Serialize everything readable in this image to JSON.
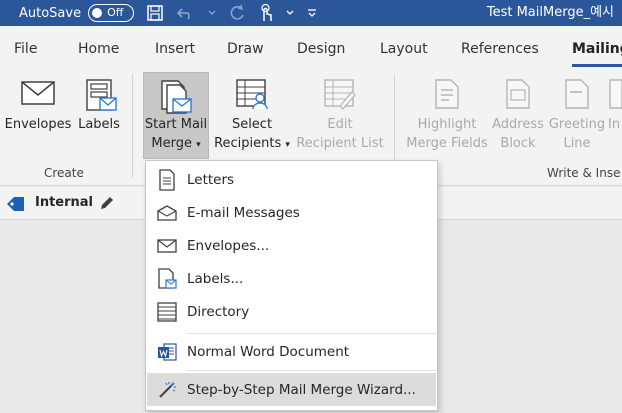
{
  "titlebar": {
    "autosave_label": "AutoSave",
    "toggle_state": "Off",
    "document_title": "Test MailMerge_예시"
  },
  "tabs": [
    {
      "label": "File"
    },
    {
      "label": "Home"
    },
    {
      "label": "Insert"
    },
    {
      "label": "Draw"
    },
    {
      "label": "Design"
    },
    {
      "label": "Layout"
    },
    {
      "label": "References"
    },
    {
      "label": "Mailing"
    }
  ],
  "ribbon": {
    "create_group_label": "Create",
    "write_group_label": "Write & Inse",
    "envelopes_label": "Envelopes",
    "labels_label": "Labels",
    "start_mail_merge_line1": "Start Mail",
    "start_mail_merge_line2": "Merge",
    "select_recipients_line1": "Select",
    "select_recipients_line2": "Recipients",
    "edit_recipient_list_line1": "Edit",
    "edit_recipient_list_line2": "Recipient List",
    "highlight_merge_fields_line1": "Highlight",
    "highlight_merge_fields_line2": "Merge Fields",
    "address_block_line1": "Address",
    "address_block_line2": "Block",
    "greeting_line_line1": "Greeting",
    "greeting_line_line2": "Line",
    "insert_merge_field_line1": "In"
  },
  "sensitivity": {
    "label": "Internal"
  },
  "menu": {
    "items": [
      {
        "label": "Letters"
      },
      {
        "label": "E-mail Messages"
      },
      {
        "label": "Envelopes..."
      },
      {
        "label": "Labels..."
      },
      {
        "label": "Directory"
      },
      {
        "label": "Normal Word Document"
      },
      {
        "label": "Step-by-Step Mail Merge Wizard..."
      }
    ]
  },
  "colors": {
    "title_bar": "#2b579a",
    "ribbon_bg": "#f3f3f3",
    "word_blue": "#2b579a",
    "highlight": "#dcdcdc"
  }
}
